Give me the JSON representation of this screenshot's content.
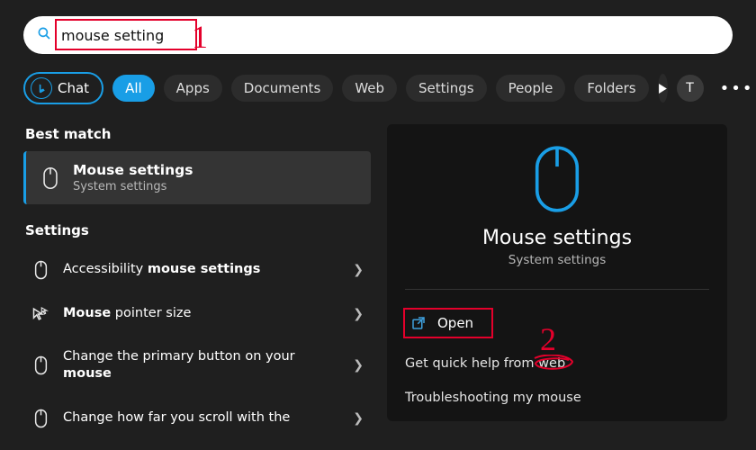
{
  "colors": {
    "accent": "#199ee6",
    "annotation": "#e4002b"
  },
  "search": {
    "value": "mouse setting"
  },
  "tabs": {
    "chat": "Chat",
    "all": "All",
    "items": [
      "Apps",
      "Documents",
      "Web",
      "Settings",
      "People",
      "Folders"
    ]
  },
  "top_right": {
    "avatar_initial": "T",
    "ellipsis": "•••"
  },
  "annotations": {
    "one": "1",
    "two": "2"
  },
  "left": {
    "best_match_heading": "Best match",
    "best_match": {
      "title": "Mouse settings",
      "subtitle": "System settings"
    },
    "settings_heading": "Settings",
    "rows": [
      {
        "prefix": "Accessibility ",
        "bold": "mouse settings",
        "suffix": ""
      },
      {
        "prefix": "",
        "bold": "Mouse",
        "suffix": " pointer size"
      },
      {
        "prefix": "Change the primary button on your ",
        "bold": "mouse",
        "suffix": ""
      },
      {
        "prefix": "Change how far you scroll with the ",
        "bold": "",
        "suffix": ""
      }
    ]
  },
  "right": {
    "title": "Mouse settings",
    "subtitle": "System settings",
    "open": "Open",
    "quick_help_prefix": "Get quick help from ",
    "quick_help_web": "web",
    "troubleshoot": "Troubleshooting my mouse"
  }
}
